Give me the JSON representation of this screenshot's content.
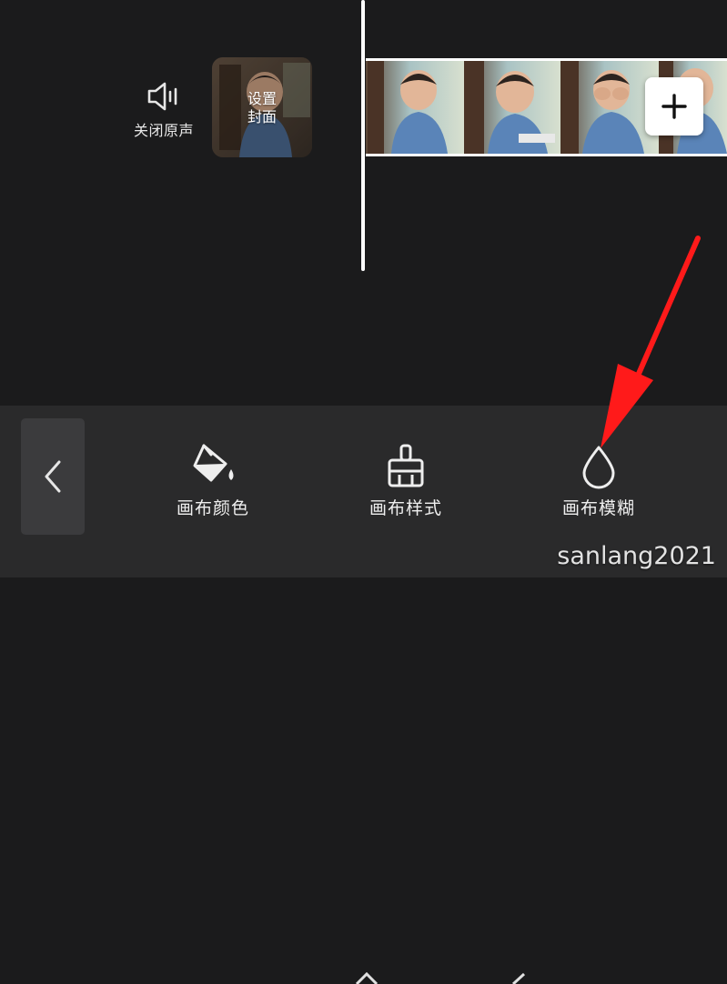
{
  "timeline": {
    "mute_label": "关闭原声",
    "cover_line1": "设置",
    "cover_line2": "封面",
    "add_clip_icon": "plus-icon"
  },
  "toolbar": {
    "back_icon": "chevron-left-icon",
    "tools": [
      {
        "label": "画布颜色",
        "icon": "paint-bucket-icon"
      },
      {
        "label": "画布样式",
        "icon": "brush-icon"
      },
      {
        "label": "画布模糊",
        "icon": "droplet-icon"
      }
    ]
  },
  "annotation": {
    "arrow_color": "#ff1a1a"
  },
  "watermark": "sanlang2021"
}
